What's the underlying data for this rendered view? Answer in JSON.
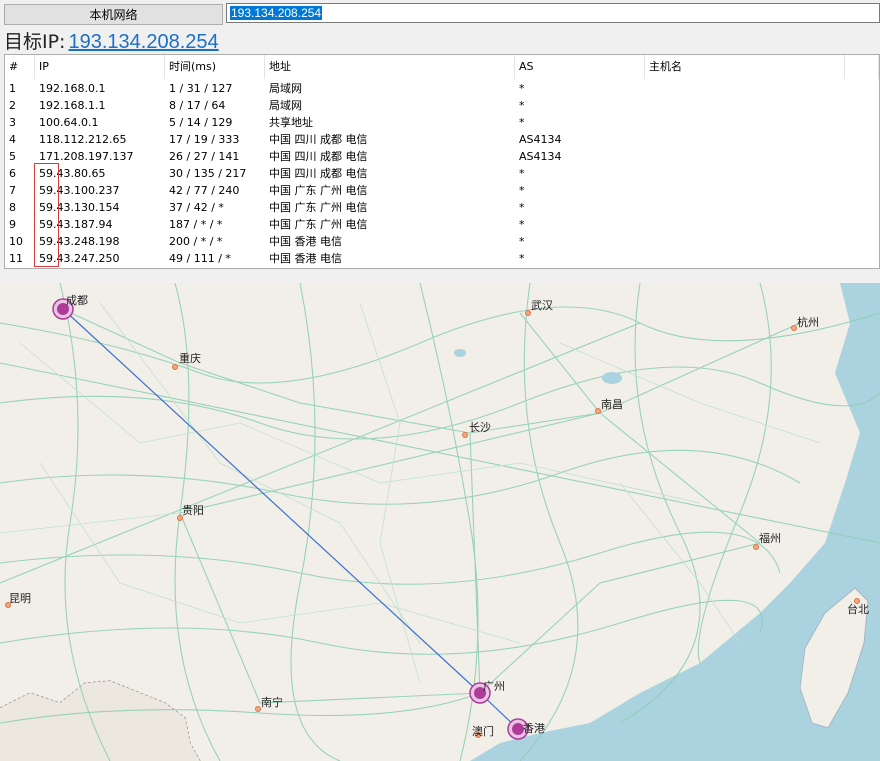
{
  "topbar": {
    "local_button": "本机网络",
    "target_value": "193.134.208.254"
  },
  "target": {
    "label": "目标IP:",
    "ip": "193.134.208.254"
  },
  "table": {
    "headers": [
      "#",
      "IP",
      "时间(ms)",
      "地址",
      "AS",
      "主机名"
    ],
    "rows": [
      {
        "n": "1",
        "ip": "192.168.0.1",
        "time": "1 / 31 / 127",
        "addr": "局域网",
        "as": "*"
      },
      {
        "n": "2",
        "ip": "192.168.1.1",
        "time": "8 / 17 / 64",
        "addr": "局域网",
        "as": "*"
      },
      {
        "n": "3",
        "ip": "100.64.0.1",
        "time": "5 / 14 / 129",
        "addr": "共享地址",
        "as": "*"
      },
      {
        "n": "4",
        "ip": "118.112.212.65",
        "time": "17 / 19 / 333",
        "addr": "中国 四川 成都 电信",
        "as": "AS4134"
      },
      {
        "n": "5",
        "ip": "171.208.197.137",
        "time": "26 / 27 / 141",
        "addr": "中国 四川 成都 电信",
        "as": "AS4134"
      },
      {
        "n": "6",
        "ip": "59.43.80.65",
        "time": "30 / 135 / 217",
        "addr": "中国 四川 成都 电信",
        "as": "*"
      },
      {
        "n": "7",
        "ip": "59.43.100.237",
        "time": "42 / 77 / 240",
        "addr": "中国 广东 广州 电信",
        "as": "*"
      },
      {
        "n": "8",
        "ip": "59.43.130.154",
        "time": "37 / 42 / *",
        "addr": "中国 广东 广州 电信",
        "as": "*"
      },
      {
        "n": "9",
        "ip": "59.43.187.94",
        "time": "187 / * / *",
        "addr": "中国 广东 广州 电信",
        "as": "*"
      },
      {
        "n": "10",
        "ip": "59.43.248.198",
        "time": "200 / * / *",
        "addr": "中国 香港 电信",
        "as": "*"
      },
      {
        "n": "11",
        "ip": "59.43.247.250",
        "time": "49 / 111 / *",
        "addr": "中国 香港 电信",
        "as": "*"
      }
    ]
  },
  "map": {
    "cities": {
      "chengdu": "成都",
      "chongqing": "重庆",
      "wuhan": "武汉",
      "hangzhou": "杭州",
      "nanchang": "南昌",
      "changsha": "长沙",
      "guiyang": "贵阳",
      "fuzhou": "福州",
      "kunming": "昆明",
      "taibei": "台北",
      "nanning": "南宁",
      "guangzhou": "广州",
      "aomen": "澳门",
      "xianggang": "香港"
    },
    "colors": {
      "route": "#3b6fd1",
      "marker": "#b03a9a",
      "water": "#aad3df",
      "road": "#8ecfb4",
      "land": "#f2efe9"
    }
  }
}
